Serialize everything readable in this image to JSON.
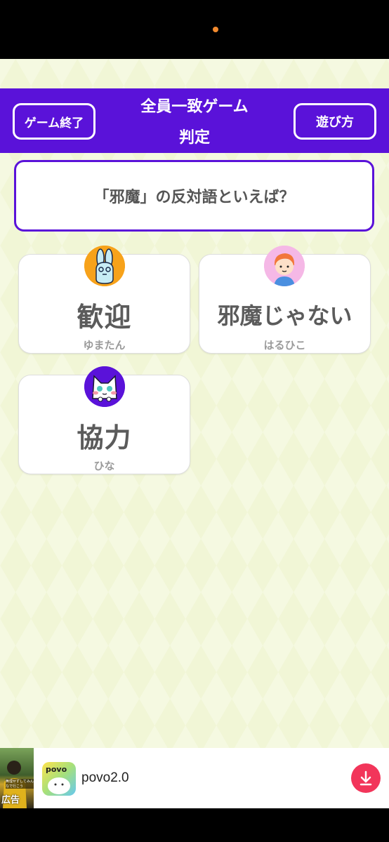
{
  "header": {
    "title_line1": "全員一致ゲーム",
    "title_line2": "判定",
    "end_button": "ゲーム終了",
    "howto_button": "遊び方"
  },
  "question": "「邪魔」の反対語といえば？",
  "answers": [
    {
      "answer": "歓迎",
      "player": "ゆまたん",
      "avatar": "rabbit-avatar-icon"
    },
    {
      "answer": "邪魔じゃない",
      "player": "はるひこ",
      "avatar": "boy-avatar-icon"
    },
    {
      "answer": "協力",
      "player": "ひな",
      "avatar": "cat-avatar-icon"
    }
  ],
  "ad": {
    "label": "広告",
    "thumb_caption": "無理せずしてみんなで行こう",
    "app_icon_text": "povo",
    "title": "povo2.0",
    "download_icon": "download-icon"
  },
  "colors": {
    "accent": "#5a12d9",
    "background": "#f1f6d6",
    "download": "#f2355a"
  }
}
